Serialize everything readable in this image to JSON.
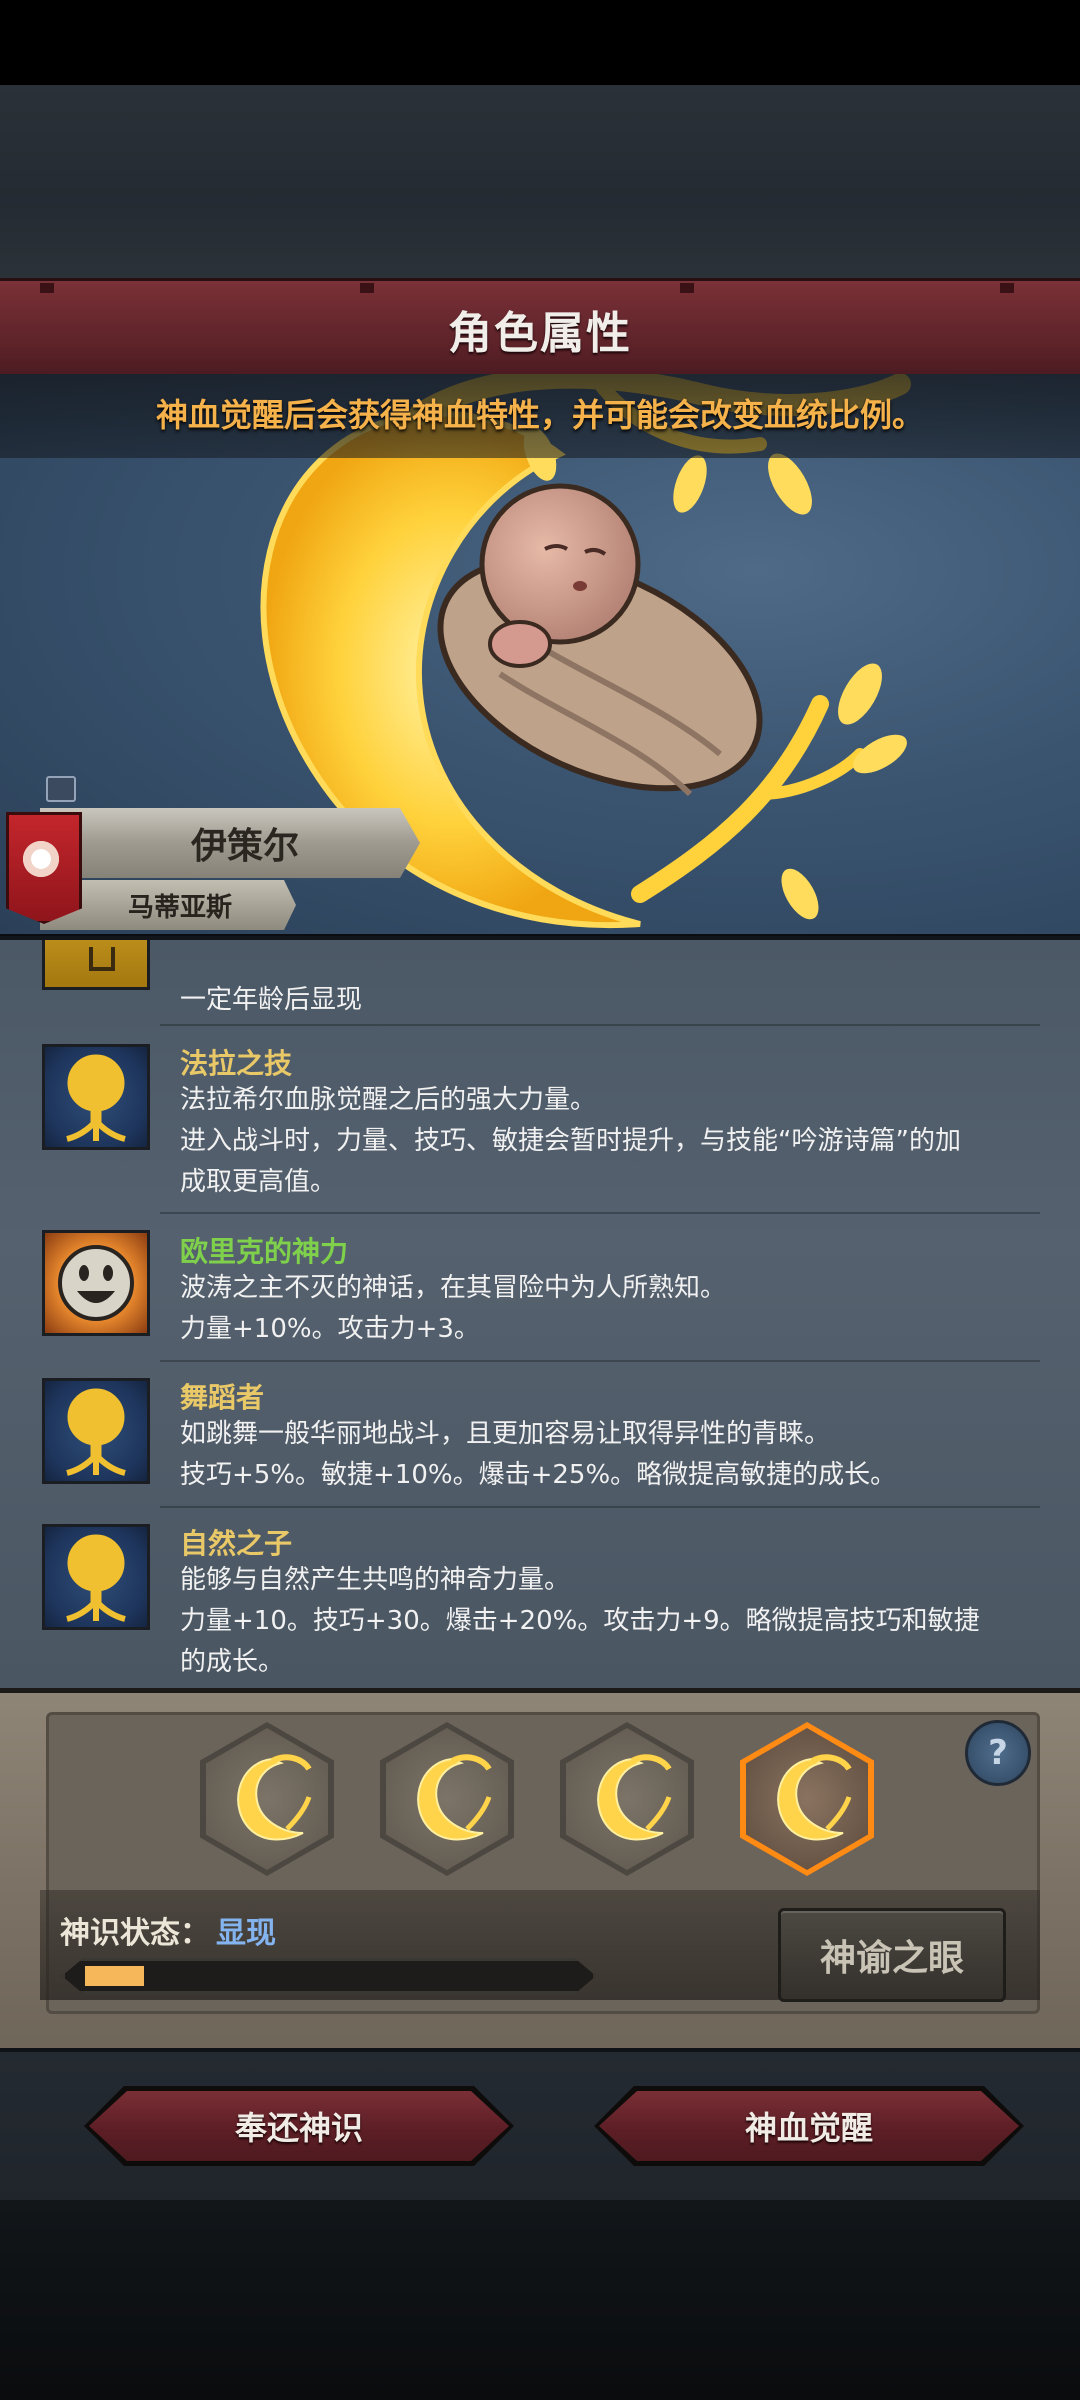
{
  "header": {
    "title": "角色属性"
  },
  "hero": {
    "notice": "神血觉醒后会获得神血特性，并可能会改变血统比例。"
  },
  "character": {
    "name": "伊策尔",
    "subtitle": "马蒂亚斯"
  },
  "traits": [
    {
      "icon": "partial-trait-icon",
      "name": "",
      "lines": [
        "一定年龄后显现"
      ]
    },
    {
      "icon": "golden-tree-icon",
      "name": "法拉之技",
      "lines": [
        "法拉希尔血脉觉醒之后的强大力量。",
        "进入战斗时，力量、技巧、敏捷会暂时提升，与技能“吟游诗篇”的加",
        "成取更高值。"
      ]
    },
    {
      "icon": "smiley-face-icon",
      "name": "欧里克的神力",
      "name_color": "#7fd04a",
      "lines": [
        "波涛之主不灭的神话，在其冒险中为人所熟知。",
        "力量+10%。攻击力+3。"
      ]
    },
    {
      "icon": "golden-tree-icon",
      "name": "舞蹈者",
      "lines": [
        "如跳舞一般华丽地战斗，且更加容易让取得异性的青睐。",
        "技巧+5%。敏捷+10%。爆击+25%。略微提高敏捷的成长。"
      ]
    },
    {
      "icon": "golden-tree-icon",
      "name": "自然之子",
      "lines": [
        "能够与自然产生共鸣的神奇力量。",
        "力量+10。技巧+30。爆击+20%。攻击力+9。略微提高技巧和敏捷",
        "的成长。"
      ]
    }
  ],
  "divine": {
    "slots": [
      {
        "icon": "golden-crescent-icon",
        "active": false
      },
      {
        "icon": "golden-crescent-icon",
        "active": false
      },
      {
        "icon": "golden-crescent-icon",
        "active": false
      },
      {
        "icon": "golden-crescent-icon",
        "active": true
      }
    ],
    "status_label": "神识状态：",
    "status_value": "显现",
    "progress": 0.12,
    "oracle_button": "神谕之眼",
    "help_icon": "question-mark-icon"
  },
  "actions": {
    "return_button": "奉还神识",
    "awaken_button": "神血觉醒"
  },
  "colors": {
    "title_banner": "#6b2a30",
    "notice_text": "#f5b14a",
    "trait_name": "#e9c867",
    "status_value": "#84b4f0",
    "active_slot": "#ff8a14",
    "progress_fill": "#f6b65a"
  }
}
